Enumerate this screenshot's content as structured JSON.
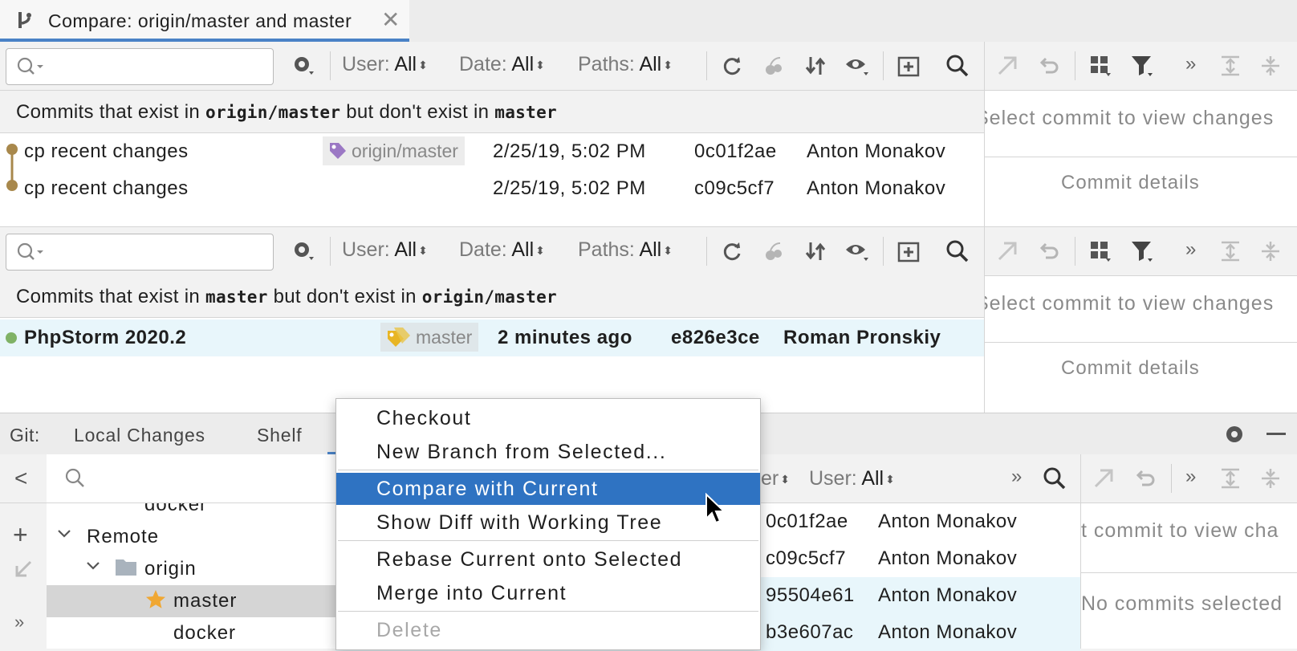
{
  "tab": {
    "title": "Compare: origin/master and master",
    "close": "✕"
  },
  "toolbar": {
    "search_placeholder": "",
    "user_label": "User:",
    "user_value": "All",
    "date_label": "Date:",
    "date_value": "All",
    "paths_label": "Paths:",
    "paths_value": "All",
    "arrows": "⬍",
    "more": "»"
  },
  "top_panel": {
    "header": {
      "prefix": "Commits that exist in",
      "branch1": "origin/master",
      "middle": "but don't exist in",
      "branch2": "master"
    },
    "commits": [
      {
        "message": "cp recent changes",
        "tag": "origin/master",
        "date": "2/25/19, 5:02 PM",
        "hash": "0c01f2ae",
        "author": "Anton Monakov"
      },
      {
        "message": "cp recent changes",
        "tag": "",
        "date": "2/25/19, 5:02 PM",
        "hash": "c09c5cf7",
        "author": "Anton Monakov"
      }
    ],
    "right_text": "Select commit to view changes",
    "details_label": "Commit details"
  },
  "bottom_panel": {
    "header": {
      "prefix": "Commits that exist in",
      "branch1": "master",
      "middle": "but don't exist in",
      "branch2": "origin/master"
    },
    "commits": [
      {
        "message": "PhpStorm 2020.2",
        "tag": "master",
        "date": "2 minutes ago",
        "hash": "e826e3ce",
        "author": "Roman Pronskiy"
      }
    ],
    "right_text": "Select commit to view changes",
    "details_label": "Commit details"
  },
  "git_tool": {
    "label": "Git:",
    "tabs": [
      "Local Changes",
      "Shelf"
    ],
    "back": "<",
    "add": "+",
    "more": "»",
    "tree": {
      "docker_top": "docker",
      "remote": "Remote",
      "origin": "origin",
      "master": "master",
      "docker": "docker"
    },
    "filter_partial": "er",
    "user_label": "User:",
    "user_value": "All",
    "log_rows": [
      {
        "hash": "0c01f2ae",
        "author": "Anton Monakov"
      },
      {
        "hash": "c09c5cf7",
        "author": "Anton Monakov"
      },
      {
        "hash": "95504e61",
        "author": "Anton Monakov"
      },
      {
        "hash": "b3e607ac",
        "author": "Anton Monakov"
      }
    ],
    "right_text": "t commit to view cha",
    "no_commits": "No commits selected"
  },
  "context_menu": {
    "items": [
      {
        "label": "Checkout"
      },
      {
        "label": "New Branch from Selected..."
      },
      {
        "label": "Compare with Current",
        "selected": true
      },
      {
        "label": "Show Diff with Working Tree"
      },
      {
        "label": "Rebase Current onto Selected"
      },
      {
        "label": "Merge into Current"
      },
      {
        "label": "Delete",
        "disabled": true
      }
    ]
  },
  "colors": {
    "accent": "#2f73c2",
    "selection_row": "#e8f6fb",
    "tree_selected": "#d5d5d5",
    "graph_brown": "#a8884c",
    "graph_green": "#7fb266"
  }
}
